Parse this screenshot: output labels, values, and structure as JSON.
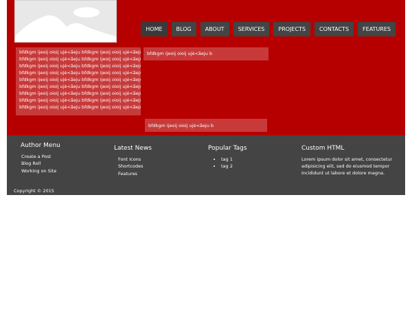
{
  "nav": {
    "items": [
      {
        "label": "HOME"
      },
      {
        "label": "BLOG"
      },
      {
        "label": "ABOUT"
      },
      {
        "label": "SERVICES"
      },
      {
        "label": "PROJECTS"
      },
      {
        "label": "CONTACTS"
      },
      {
        "label": "FEATURES"
      }
    ]
  },
  "logo": {
    "icon": "image-placeholder-icon"
  },
  "content": {
    "left_panel_lines": [
      "bfdkgm ijeoij oioij ujė<ãeju bfdkgm ijeoij oioij ujė<ãeju",
      "bfdkgm ijeoij oioij ujė<ãeju bfdkgm ijeoij oioij ujė<ãeju",
      "bfdkgm ijeoij oioij ujė<ãeju bfdkgm ijeoij oioij ujė<ãeju",
      "bfdkgm ijeoij oioij ujė<ãeju bfdkgm ijeoij oioij ujė<ãeju",
      "bfdkgm ijeoij oioij ujė<ãeju bfdkgm ijeoij oioij ujė<ãeju",
      "bfdkgm ijeoij oioij ujė<ãeju bfdkgm ijeoij oioij ujė<ãeju",
      "bfdkgm ijeoij oioij ujė<ãeju bfdkgm ijeoij oioij ujė<ãeju",
      "bfdkgm ijeoij oioij ujė<ãeju bfdkgm ijeoij oioij ujė<ãeju",
      "bfdkgm ijeoij oioij ujė<ãeju bfdkgm ijeoij oioij ujė<ãeju b"
    ],
    "mid_panel_text": "bfdkgm ijeoij oioij ujė<ãeju b",
    "bottom_panel_text": "bfdkgm ijeoij oioij ujė<ãeju b"
  },
  "footer": {
    "author_menu": {
      "title": "Author Menu",
      "links": [
        "Create a Post",
        "Blog Roll",
        "Working on Site"
      ]
    },
    "latest_news": {
      "title": "Latest News",
      "links": [
        "Font Icons",
        "Shortcodes",
        "Features"
      ]
    },
    "popular_tags": {
      "title": "Popular Tags",
      "tags": [
        "tag 1",
        "tag 2"
      ]
    },
    "custom_html": {
      "title": "Custom HTML",
      "text": "Lorem ipsum dolor sit amet, consectetur adipisicing elit, sed do eiusmod tempor incididunt ut labore et dolore magna."
    },
    "copyright": "Copyright © 2015"
  },
  "colors": {
    "header_bg": "#b60000",
    "panel_bg": "#c83a3a",
    "footer_bg": "#444444",
    "nav_bg": "#444444"
  }
}
